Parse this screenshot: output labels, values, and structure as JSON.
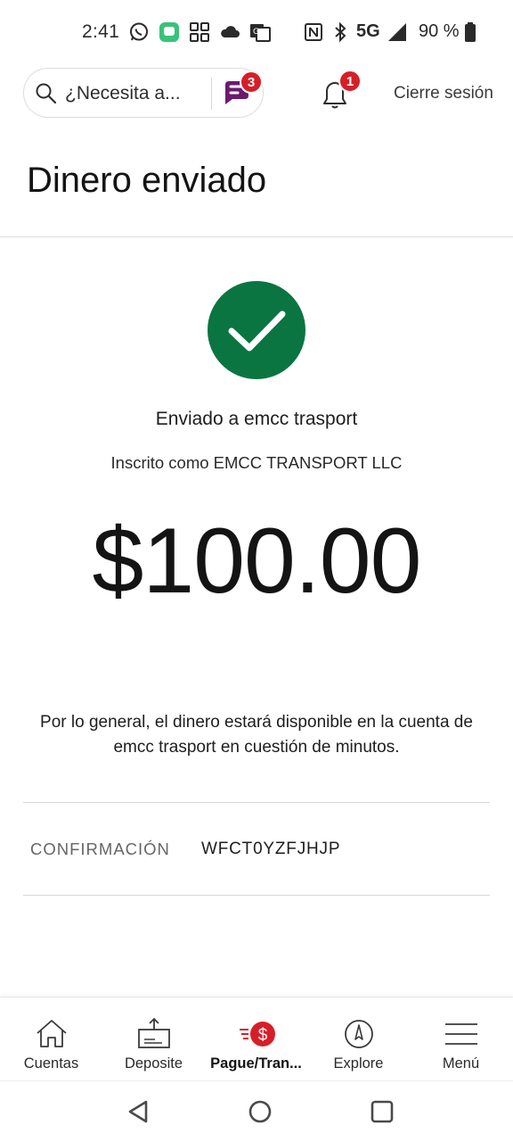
{
  "status_bar": {
    "time": "2:41",
    "network": "5G",
    "battery": "90 %",
    "icons": [
      "whatsapp-icon",
      "messages-icon",
      "grid-app-icon",
      "cloud-icon",
      "translate-icon",
      "nfc-icon",
      "bluetooth-icon",
      "signal-icon",
      "battery-icon"
    ]
  },
  "header": {
    "search_placeholder": "¿Necesita a...",
    "fargo_badge": "3",
    "notifications_badge": "1",
    "signout_label": "Cierre sesión"
  },
  "page_title": "Dinero enviado",
  "success": {
    "sent_to": "Enviado a emcc trasport",
    "enrolled_as": "Inscrito como EMCC TRANSPORT LLC",
    "amount": "$100.00",
    "availability_note": "Por lo general, el dinero estará disponible en la cuenta de emcc trasport en cuestión de minutos."
  },
  "confirmation": {
    "label": "CONFIRMACIÓN",
    "value": "WFCT0YZFJHJP"
  },
  "bottom_nav": [
    {
      "label": "Cuentas",
      "icon": "house-icon",
      "active": false
    },
    {
      "label": "Deposite",
      "icon": "deposit-icon",
      "active": false
    },
    {
      "label": "Pague/Tran...",
      "icon": "pay-transfer-icon",
      "active": true
    },
    {
      "label": "Explore",
      "icon": "compass-icon",
      "active": false
    },
    {
      "label": "Menú",
      "icon": "hamburger-menu-icon",
      "active": false
    }
  ],
  "colors": {
    "success_green": "#0a7540",
    "badge_red": "#d71e28",
    "fargo_purple": "#6b1b6e"
  }
}
